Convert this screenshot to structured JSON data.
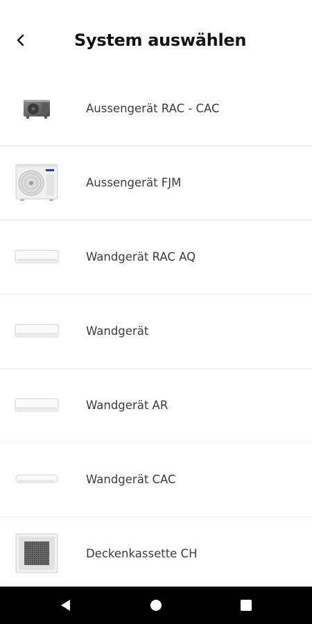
{
  "header": {
    "title": "System auswählen",
    "back_icon": "chevron-left-icon"
  },
  "items": [
    {
      "label": "Aussengerät RAC - CAC",
      "icon": "outdoor-unit-small-icon"
    },
    {
      "label": "Aussengerät FJM",
      "icon": "outdoor-unit-fan-icon"
    },
    {
      "label": "Wandgerät RAC AQ",
      "icon": "wall-unit-icon"
    },
    {
      "label": "Wandgerät",
      "icon": "wall-unit-icon"
    },
    {
      "label": "Wandgerät AR",
      "icon": "wall-unit-icon"
    },
    {
      "label": "Wandgerät CAC",
      "icon": "wall-unit-slim-icon"
    },
    {
      "label": "Deckenkassette CH",
      "icon": "ceiling-cassette-icon"
    }
  ],
  "navbar": {
    "back_icon": "nav-back-icon",
    "home_icon": "nav-home-icon",
    "recents_icon": "nav-recents-icon"
  }
}
